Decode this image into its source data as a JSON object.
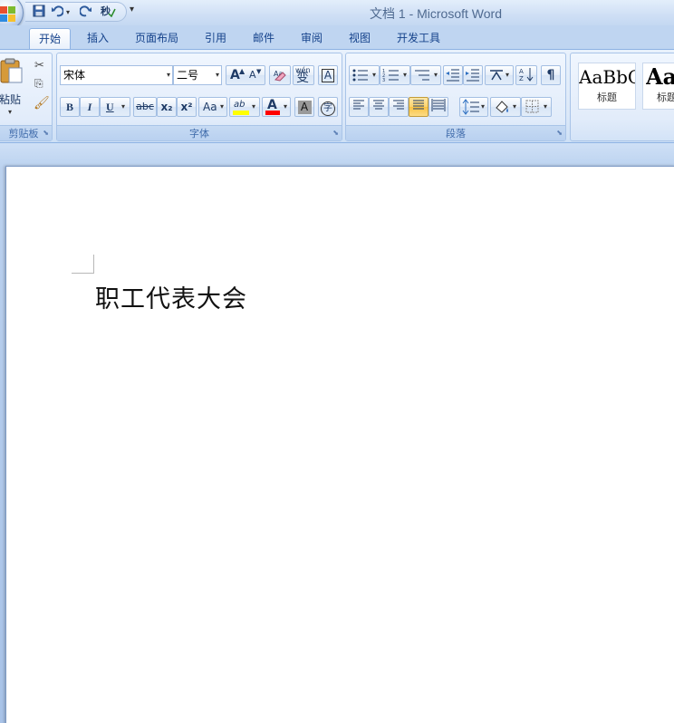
{
  "app": {
    "title": "文档 1 - Microsoft Word"
  },
  "quick_access": {
    "save_icon": "save-icon",
    "undo_icon": "undo-icon",
    "redo_icon": "redo-icon",
    "spelling_icon": "spelling-check-icon"
  },
  "tabs": [
    {
      "label": "开始",
      "active": true
    },
    {
      "label": "插入"
    },
    {
      "label": "页面布局"
    },
    {
      "label": "引用"
    },
    {
      "label": "邮件"
    },
    {
      "label": "审阅"
    },
    {
      "label": "视图"
    },
    {
      "label": "开发工具"
    }
  ],
  "clipboard": {
    "paste_label": "粘贴",
    "group_label": "剪贴板"
  },
  "font": {
    "font_name": "宋体",
    "font_size": "二号",
    "group_label": "字体",
    "grow_label": "A",
    "shrink_label": "A",
    "phonetic_label": "wén",
    "phonetic_char": "变",
    "border_char": "A",
    "bold": "B",
    "italic": "I",
    "underline": "U",
    "strike": "abc",
    "subscript": "x₂",
    "superscript": "x²",
    "case": "Aa",
    "highlight_label": "ab",
    "font_color": "A",
    "shade_char": "A",
    "enclose_char": "字"
  },
  "paragraph": {
    "group_label": "段落"
  },
  "styles": {
    "items": [
      {
        "sample": "AaBbC",
        "name": "标题"
      },
      {
        "sample": "Aa",
        "name": "标题"
      }
    ]
  },
  "document": {
    "text": "职工代表大会"
  },
  "colors": {
    "accent": "#15428b",
    "highlight": "#ffff00",
    "font_color": "#ff0000"
  }
}
